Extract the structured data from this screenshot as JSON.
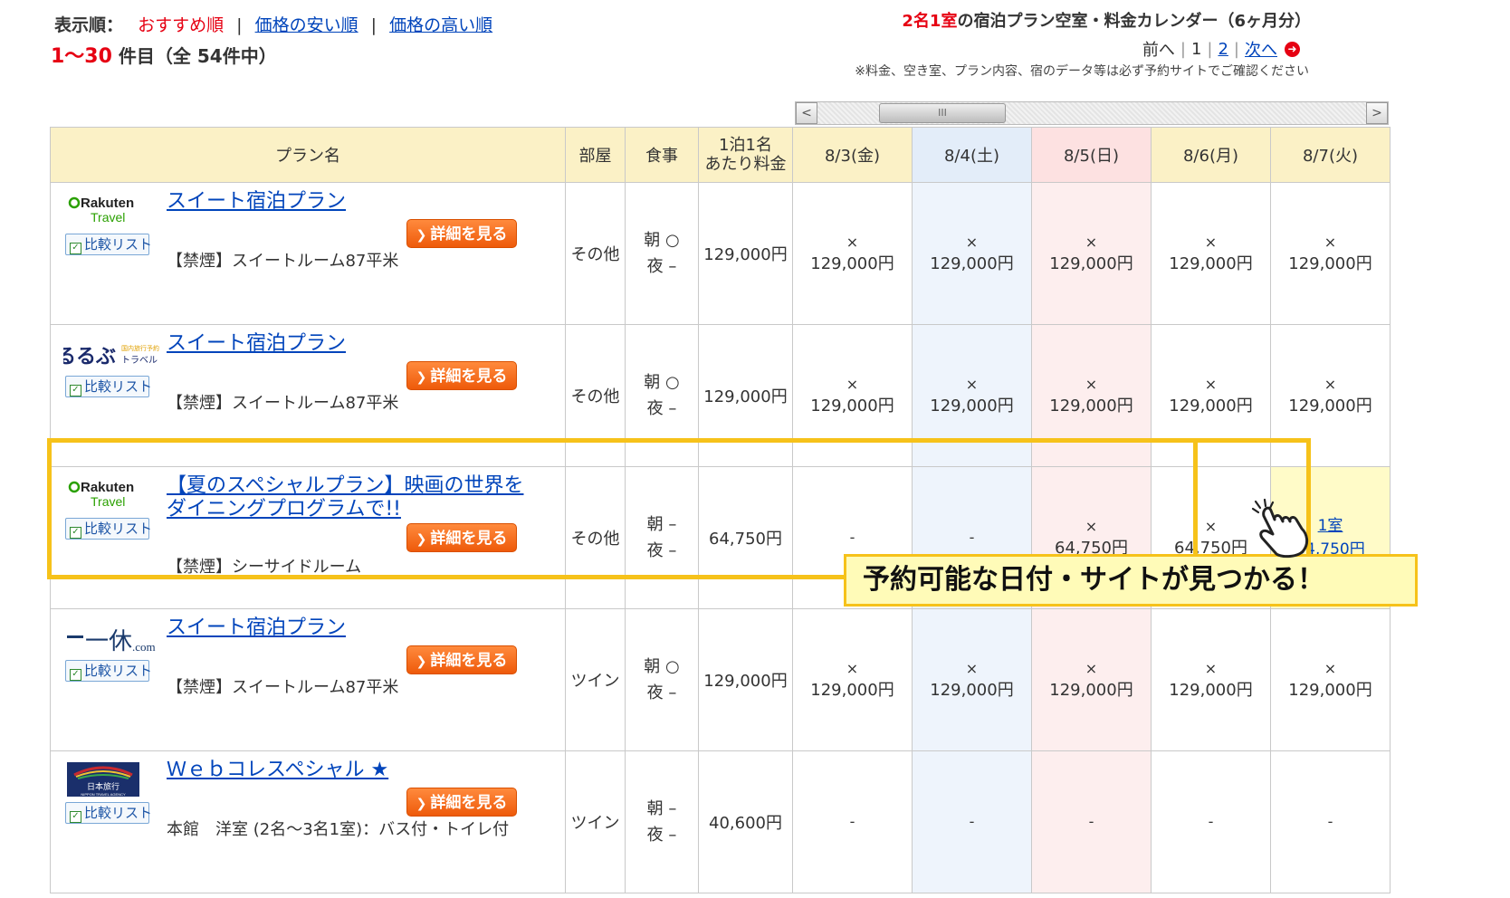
{
  "header": {
    "sort_label": "表示順：",
    "sort_active": "おすすめ順",
    "sort_separator": "|",
    "sort_cheap": "価格の安い順",
    "sort_expensive": "価格の高い順",
    "count_range": "1〜30",
    "count_suffix": " 件目（全 54件中）"
  },
  "calendar": {
    "title_red": "2名1室",
    "title_rest": "の宿泊プラン空室・料金カレンダー（6ヶ月分）",
    "pager_prev": "前へ",
    "pager_sep": "|",
    "pager_page1": "1",
    "pager_page2": "2",
    "pager_next": "次へ",
    "pager_next_icon": "➜",
    "notice": "※料金、空き室、プラン内容、宿のデータ等は必ず予約サイトでご確認ください",
    "scroll_left": "<",
    "scroll_right": ">",
    "scroll_grip": "III"
  },
  "table": {
    "headers": {
      "plan": "プラン名",
      "room": "部屋",
      "meal": "食事",
      "price_line1": "1泊1名",
      "price_line2": "あたり料金"
    },
    "dates": [
      "8/3(金)",
      "8/4(土)",
      "8/5(日)",
      "8/6(月)",
      "8/7(火)"
    ],
    "compare_label": "比較リスト",
    "detail_label": "詳細を見る",
    "rows": [
      {
        "site": "Rakuten Travel",
        "plan_name": "スイート宿泊プラン",
        "room_desc": "【禁煙】スイートルーム87平米",
        "room_type": "その他",
        "meal_breakfast": "朝 ○",
        "meal_dinner": "夜 –",
        "price": "129,000円",
        "cells": [
          {
            "mark": "×",
            "price": "129,000円"
          },
          {
            "mark": "×",
            "price": "129,000円"
          },
          {
            "mark": "×",
            "price": "129,000円"
          },
          {
            "mark": "×",
            "price": "129,000円"
          },
          {
            "mark": "×",
            "price": "129,000円"
          }
        ]
      },
      {
        "site": "るるぶトラベル",
        "plan_name": "スイート宿泊プラン",
        "room_desc": "【禁煙】スイートルーム87平米",
        "room_type": "その他",
        "meal_breakfast": "朝 ○",
        "meal_dinner": "夜 –",
        "price": "129,000円",
        "cells": [
          {
            "mark": "×",
            "price": "129,000円"
          },
          {
            "mark": "×",
            "price": "129,000円"
          },
          {
            "mark": "×",
            "price": "129,000円"
          },
          {
            "mark": "×",
            "price": "129,000円"
          },
          {
            "mark": "×",
            "price": "129,000円"
          }
        ]
      },
      {
        "site": "Rakuten Travel",
        "plan_name": "【夏のスペシャルプラン】映画の世界をダイニングプログラムで!!",
        "room_desc": "【禁煙】シーサイドルーム",
        "room_type": "その他",
        "meal_breakfast": "朝 –",
        "meal_dinner": "夜 –",
        "price": "64,750円",
        "cells": [
          {
            "mark": "-",
            "price": ""
          },
          {
            "mark": "-",
            "price": ""
          },
          {
            "mark": "×",
            "price": "64,750円"
          },
          {
            "mark": "×",
            "price": "64,750円"
          },
          {
            "mark": "1室",
            "price": "64,750円",
            "available": true
          }
        ]
      },
      {
        "site": "一休.com",
        "plan_name": "スイート宿泊プラン",
        "room_desc": "【禁煙】スイートルーム87平米",
        "room_type": "ツイン",
        "meal_breakfast": "朝 ○",
        "meal_dinner": "夜 –",
        "price": "129,000円",
        "cells": [
          {
            "mark": "×",
            "price": "129,000円"
          },
          {
            "mark": "×",
            "price": "129,000円"
          },
          {
            "mark": "×",
            "price": "129,000円"
          },
          {
            "mark": "×",
            "price": "129,000円"
          },
          {
            "mark": "×",
            "price": "129,000円"
          }
        ]
      },
      {
        "site": "日本旅行",
        "plan_name": "Ｗｅｂコレスペシャル ★",
        "room_desc": "本館　洋室 (2名〜3名1室)：バス付・トイレ付",
        "room_type": "ツイン",
        "meal_breakfast": "朝 –",
        "meal_dinner": "夜 –",
        "price": "40,600円",
        "cells": [
          {
            "mark": "-",
            "price": ""
          },
          {
            "mark": "-",
            "price": ""
          },
          {
            "mark": "-",
            "price": ""
          },
          {
            "mark": "-",
            "price": ""
          },
          {
            "mark": "-",
            "price": ""
          }
        ]
      }
    ]
  },
  "callout": {
    "text": "予約可能な日付・サイトが見つかる！"
  },
  "logos": {
    "rakuten_line1": "Rakuten",
    "rakuten_line2": "Travel",
    "rurubu_main": "るるぶ",
    "rurubu_top": "国内旅行予約",
    "rurubu_sub": "トラベル",
    "ikyu_main": "一休",
    "ikyu_sub": ".com",
    "nta_main": "日本旅行",
    "nta_sub": "NIPPON TRAVEL AGENCY"
  },
  "colors": {
    "accent_red": "#e60012",
    "link_blue": "#0044bb",
    "header_bg": "#fbf1c6",
    "highlight_border": "#f6c21a",
    "button_orange": "#ee5a0a"
  }
}
